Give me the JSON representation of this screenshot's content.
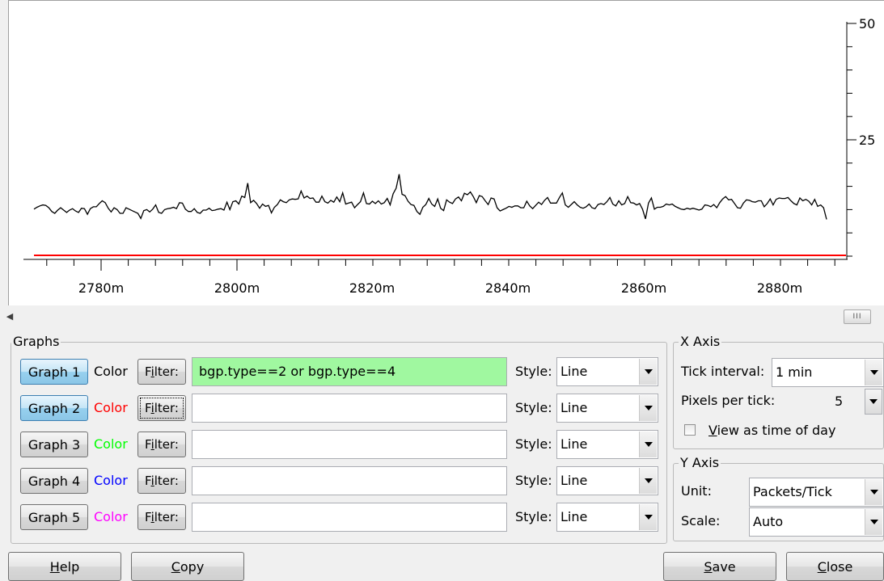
{
  "graph": {
    "y_ticks": [
      "50",
      "25"
    ],
    "x_ticks": [
      "2780m",
      "2800m",
      "2820m",
      "2840m",
      "2860m",
      "2880m"
    ],
    "chart_data": {
      "type": "line",
      "x_ticks": [
        "2780m",
        "2800m",
        "2820m",
        "2840m",
        "2860m",
        "2880m"
      ],
      "y_ticks": [
        "50",
        "25"
      ],
      "series": [
        {
          "color": "#000000",
          "values": [
            10.1,
            10.5,
            10.8,
            11.0,
            10.9,
            10.4,
            9.6,
            9.2,
            9.9,
            10.4,
            9.9,
            9.4,
            9.9,
            10.2,
            9.7,
            9.4,
            10.3,
            10.2,
            9.0,
            10.2,
            10.6,
            10.6,
            11.3,
            11.9,
            11.5,
            10.3,
            9.5,
            10.4,
            10.0,
            9.2,
            9.2,
            10.4,
            10.1,
            9.8,
            9.5,
            9.2,
            8.1,
            9.8,
            10.0,
            9.5,
            10.1,
            11.0,
            9.4,
            9.2,
            10.0,
            10.2,
            10.3,
            10.5,
            10.2,
            11.5,
            11.4,
            10.1,
            9.6,
            9.6,
            10.2,
            9.4,
            9.2,
            9.9,
            9.9,
            10.3,
            9.8,
            9.9,
            10.1,
            10.2,
            9.9,
            11.6,
            10.0,
            11.7,
            11.9,
            11.2,
            12.9,
            12.6,
            15.7,
            11.5,
            12.0,
            11.3,
            10.3,
            11.2,
            10.7,
            10.9,
            9.3,
            10.5,
            11.1,
            12.1,
            11.7,
            11.5,
            12.1,
            12.3,
            12.2,
            12.3,
            14.0,
            12.5,
            12.9,
            12.4,
            12.5,
            11.6,
            11.6,
            12.9,
            11.7,
            11.4,
            12.0,
            11.6,
            12.7,
            11.7,
            13.6,
            11.2,
            11.4,
            11.6,
            10.4,
            11.1,
            11.7,
            13.6,
            11.3,
            11.2,
            11.8,
            11.3,
            11.9,
            11.2,
            11.5,
            12.4,
            11.0,
            13.4,
            14.6,
            17.6,
            13.3,
            13.0,
            11.8,
            11.1,
            10.9,
            9.6,
            9.0,
            10.5,
            11.1,
            12.4,
            11.2,
            10.7,
            12.3,
            10.3,
            9.8,
            12.1,
            11.6,
            11.3,
            12.3,
            12.7,
            11.9,
            13.5,
            13.2,
            13.8,
            12.8,
            11.5,
            13.0,
            12.8,
            11.9,
            11.1,
            12.5,
            12.3,
            10.4,
            9.7,
            10.0,
            10.3,
            10.7,
            10.5,
            10.8,
            10.8,
            10.4,
            10.4,
            11.8,
            10.8,
            10.2,
            10.9,
            11.6,
            11.1,
            12.0,
            12.6,
            11.4,
            11.4,
            11.4,
            12.6,
            13.6,
            11.0,
            10.5,
            11.1,
            11.7,
            11.0,
            10.5,
            10.3,
            10.6,
            11.2,
            10.4,
            10.2,
            11.1,
            11.3,
            11.1,
            11.7,
            12.6,
            11.2,
            10.8,
            11.9,
            11.0,
            11.3,
            12.8,
            11.5,
            11.4,
            11.0,
            11.3,
            10.1,
            8.0,
            11.4,
            12.5,
            10.1,
            10.5,
            10.5,
            10.7,
            11.2,
            11.0,
            11.2,
            10.7,
            10.4,
            10.1,
            10.0,
            10.3,
            10.1,
            10.3,
            10.1,
            9.9,
            10.1,
            11.0,
            10.9,
            10.6,
            11.1,
            10.4,
            11.5,
            12.3,
            12.8,
            12.1,
            12.2,
            11.3,
            10.4,
            10.3,
            11.4,
            12.1,
            12.0,
            11.7,
            11.6,
            11.9,
            11.9,
            10.6,
            11.3,
            12.3,
            11.0,
            12.2,
            12.5,
            12.4,
            12.4,
            12.6,
            11.9,
            11.3,
            11.0,
            12.5,
            11.9,
            12.2,
            11.8,
            11.0,
            12.2,
            10.7,
            11.0,
            10.4,
            7.9
          ]
        },
        {
          "color": "#ff0000",
          "values": [
            0.0
          ]
        }
      ]
    }
  },
  "scrollbar": {
    "left_arrow": "◀",
    "thumb_grip": "III"
  },
  "graphs_group": {
    "title": "Graphs",
    "color_label": "Color",
    "filter_label": "Filter:",
    "style_label": "Style:",
    "rows": [
      {
        "button": "Graph 1",
        "color": "#000000",
        "filter_value": "bgp.type==2 or bgp.type==4",
        "style": "Line"
      },
      {
        "button": "Graph 2",
        "color": "#ff0000",
        "filter_value": "",
        "style": "Line"
      },
      {
        "button": "Graph 3",
        "color": "#00ff00",
        "filter_value": "",
        "style": "Line"
      },
      {
        "button": "Graph 4",
        "color": "#0000ff",
        "filter_value": "",
        "style": "Line"
      },
      {
        "button": "Graph 5",
        "color": "#ff00ff",
        "filter_value": "",
        "style": "Line"
      }
    ]
  },
  "x_axis": {
    "title": "X Axis",
    "tick_interval_label": "Tick interval:",
    "tick_interval_value": "1 min",
    "pixels_per_tick_label": "Pixels per tick:",
    "pixels_per_tick_value": "5",
    "view_as_time_label": "View as time of day"
  },
  "y_axis": {
    "title": "Y Axis",
    "unit_label": "Unit:",
    "unit_value": "Packets/Tick",
    "scale_label": "Scale:",
    "scale_value": "Auto"
  },
  "footer": {
    "help": "Help",
    "copy": "Copy",
    "save": "Save",
    "close": "Close"
  }
}
